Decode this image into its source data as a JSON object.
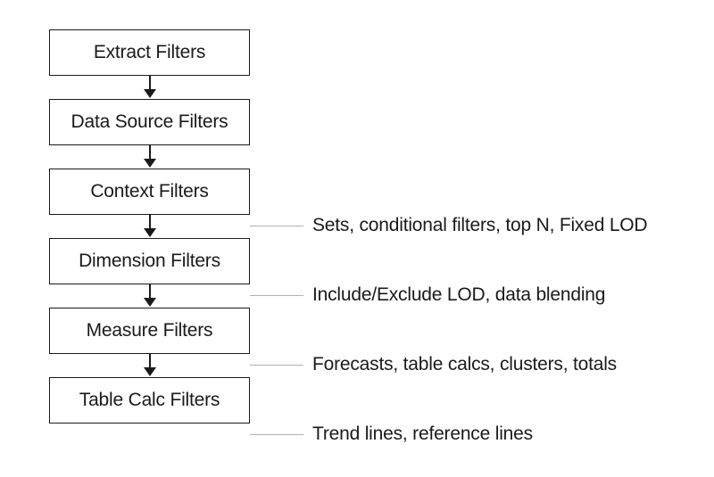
{
  "stages": {
    "s1": "Extract Filters",
    "s2": "Data Source Filters",
    "s3": "Context Filters",
    "s4": "Dimension Filters",
    "s5": "Measure Filters",
    "s6": "Table Calc Filters"
  },
  "annotations": {
    "a1": "Sets, conditional filters, top N, Fixed LOD",
    "a2": "Include/Exclude LOD, data blending",
    "a3": "Forecasts, table calcs, clusters, totals",
    "a4": "Trend lines, reference lines"
  }
}
